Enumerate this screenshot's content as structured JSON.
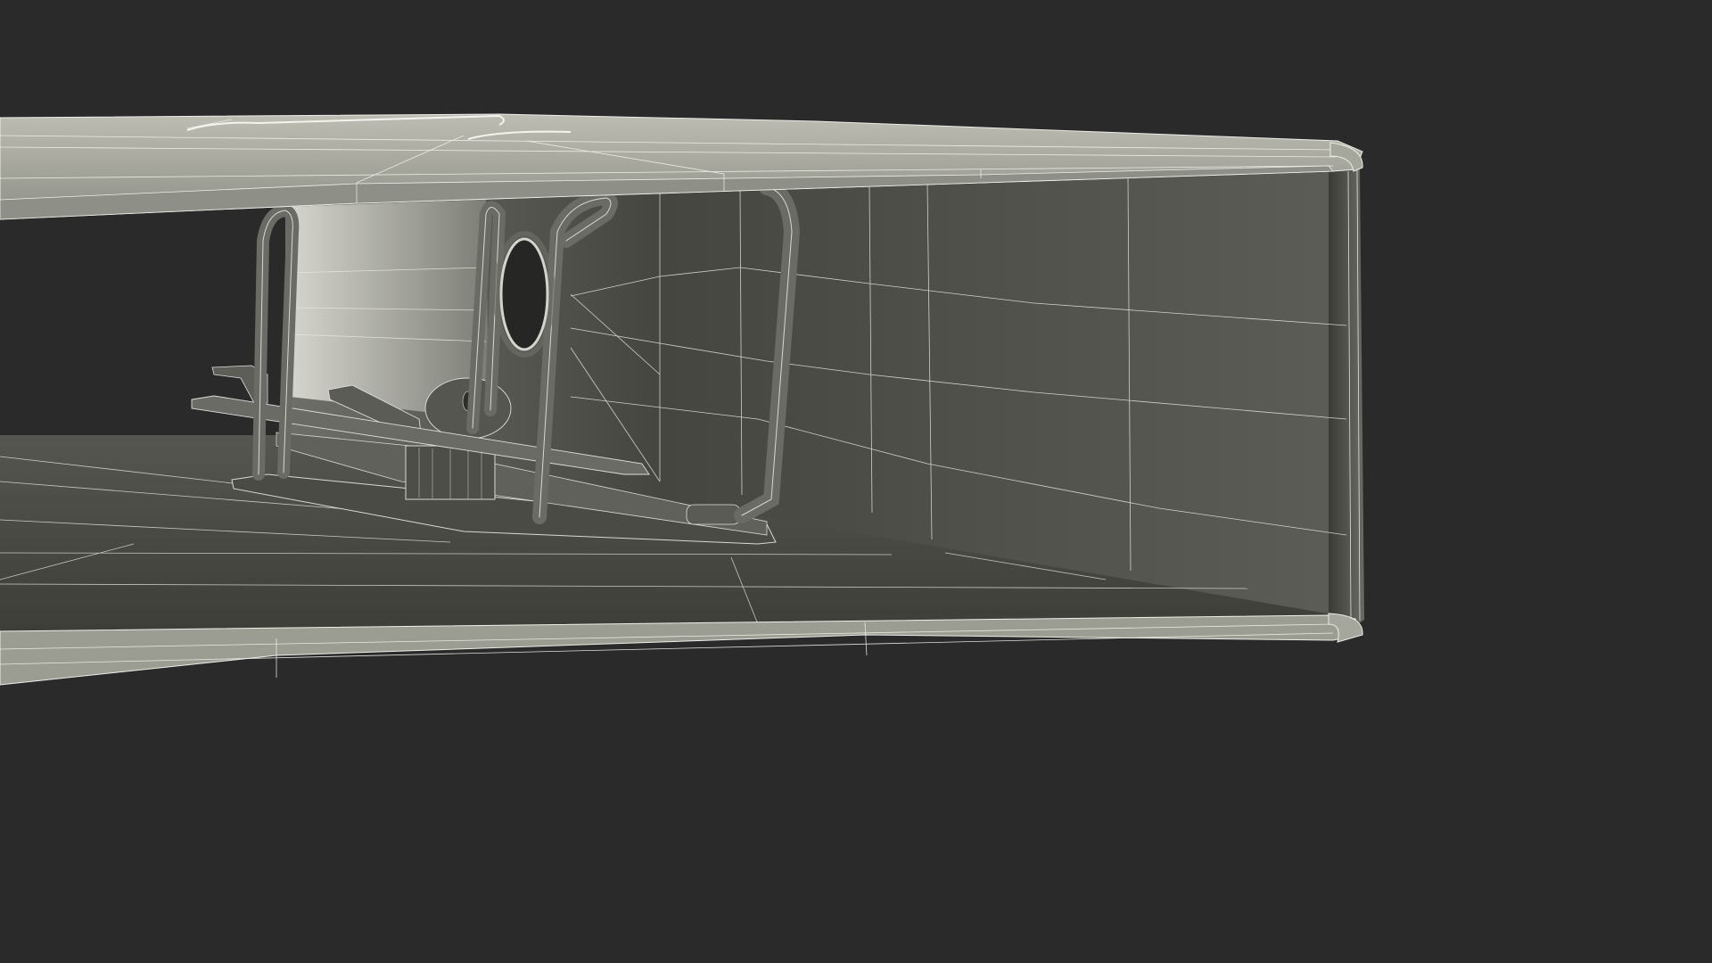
{
  "scene": {
    "colors": {
      "background": "#2a2a2a",
      "surface_light": "#c9c9bf",
      "surface_mid": "#8a8b82",
      "interior_dark": "#3c3d38",
      "wire": "#f2f2ec",
      "mechanism": "#6f706a"
    }
  }
}
